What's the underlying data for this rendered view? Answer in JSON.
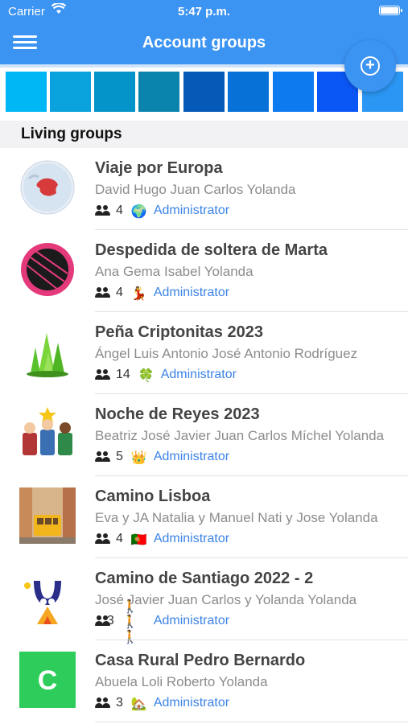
{
  "status_bar": {
    "carrier": "Carrier",
    "time": "5:47 p.m."
  },
  "header": {
    "title": "Account groups"
  },
  "palette": {
    "colors": [
      "#00b7f5",
      "#0aa2dd",
      "#0494c9",
      "#0a84ad",
      "#0559b7",
      "#0771d8",
      "#0d7af0",
      "#0b57f6",
      "#2b96f3"
    ]
  },
  "section": {
    "title": "Living groups"
  },
  "groups": [
    {
      "name": "Viaje por Europa",
      "members": "David Hugo Juan Carlos Yolanda",
      "count": "4",
      "emoji": "🌍",
      "role": "Administrator",
      "avatar": "europe-globe"
    },
    {
      "name": "Despedida de soltera de Marta",
      "members": "Ana Gema Isabel Yolanda",
      "count": "4",
      "emoji": "💃",
      "role": "Administrator",
      "avatar": "soltera-badge",
      "avatar_text": "Soltera"
    },
    {
      "name": "Peña Criptonitas 2023",
      "members": "Ángel Luis Antonio José Antonio Rodríguez",
      "count": "14",
      "emoji": "🍀",
      "role": "Administrator",
      "avatar": "green-crystals"
    },
    {
      "name": "Noche de Reyes 2023",
      "members": "Beatriz José Javier Juan Carlos Míchel Yolanda",
      "count": "5",
      "emoji": "👑",
      "role": "Administrator",
      "avatar": "three-kings"
    },
    {
      "name": "Camino Lisboa",
      "members": "Eva y JA Natalia y Manuel Nati y Jose Yolanda",
      "count": "4",
      "emoji": "🇵🇹",
      "role": "Administrator",
      "avatar": "lisbon-tram"
    },
    {
      "name": "Camino de Santiago 2022 - 2",
      "members": "José Javier Juan Carlos y Yolanda Yolanda",
      "count": "3",
      "emoji": "🚶 🚶 🚶",
      "role": "Administrator",
      "avatar": "santiago-logo"
    },
    {
      "name": "Casa Rural Pedro Bernardo",
      "members": "Abuela Loli Roberto Yolanda",
      "count": "3",
      "emoji": "🏡",
      "role": "Administrator",
      "avatar": "letter-c",
      "avatar_letter": "C",
      "avatar_color": "#2ecc5a"
    }
  ]
}
